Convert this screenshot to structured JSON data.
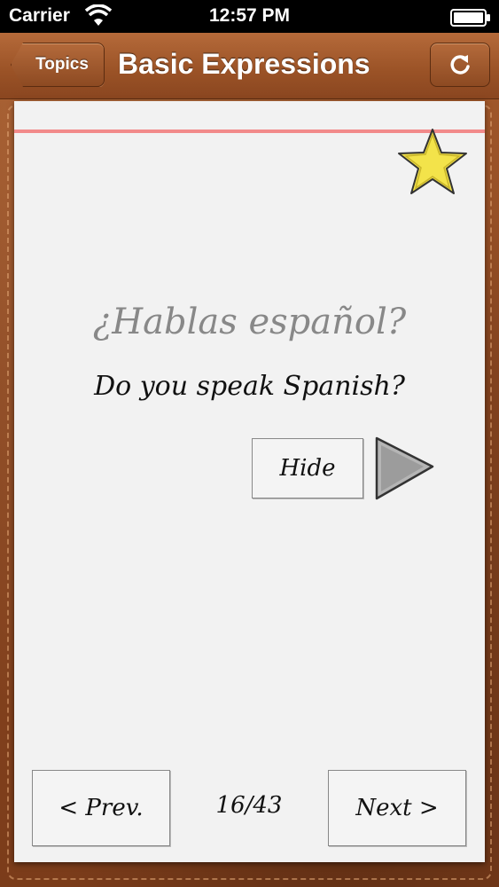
{
  "status_bar": {
    "carrier": "Carrier",
    "time": "12:57 PM",
    "icons": [
      "wifi-icon",
      "battery-icon"
    ]
  },
  "nav": {
    "back_label": "Topics",
    "title": "Basic Expressions",
    "refresh_icon": "refresh-icon"
  },
  "card": {
    "phrase_spanish": "¿Hablas español?",
    "phrase_english": "Do you speak Spanish?",
    "hide_label": "Hide",
    "play_icon": "play-icon",
    "favorite_icon": "star-icon"
  },
  "pager": {
    "prev_label": "< Prev.",
    "counter": "16/43",
    "next_label": "Next >"
  },
  "colors": {
    "leather": "#8a4620",
    "card": "#f2f2f2",
    "card_line": "#f28a8a",
    "star": "#f3e34a"
  }
}
